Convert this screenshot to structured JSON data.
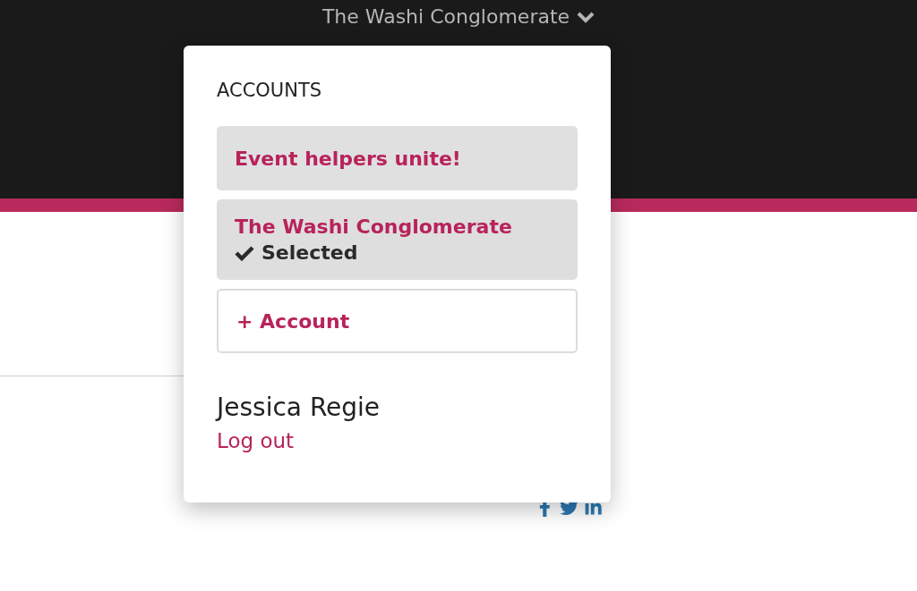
{
  "header": {
    "account_switcher": "The Washi Conglomerate"
  },
  "menu": {
    "heading": "ACCOUNTS",
    "accounts": [
      {
        "name": "Event helpers unite!",
        "selected": false
      },
      {
        "name": "The Washi Conglomerate",
        "selected": true
      }
    ],
    "selected_label": "Selected",
    "add_button": "+ Account",
    "user_name": "Jessica Regie",
    "logout": "Log out"
  }
}
